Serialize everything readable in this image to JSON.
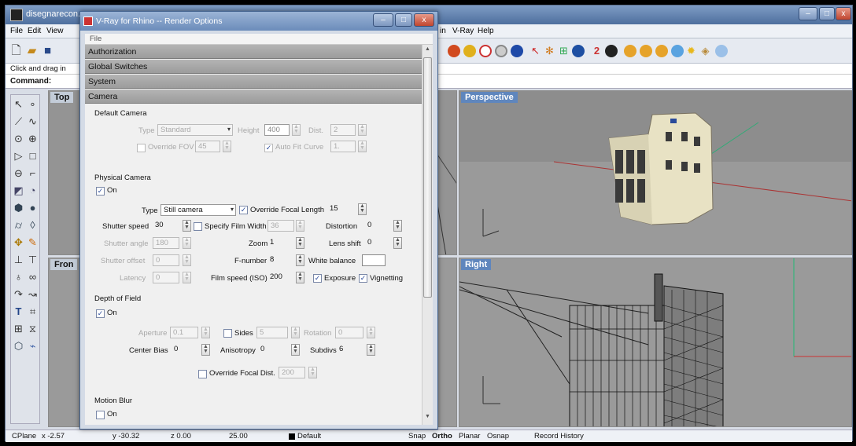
{
  "rhino": {
    "title": "disegnarecon...",
    "menu": [
      "File",
      "Edit",
      "View",
      "in",
      "V-Ray",
      "Help"
    ],
    "command_hint": "Click and drag in",
    "command_label": "Command:",
    "viewports": {
      "top": "Top",
      "front": "Fron",
      "perspective": "Perspective",
      "right": "Right"
    },
    "status": {
      "cplane": "CPlane",
      "x": "x -2.57",
      "y": "y -30.32",
      "z": "z 0.00",
      "value": "25.00",
      "layer": "Default",
      "snap": "Snap",
      "ortho": "Ortho",
      "planar": "Planar",
      "osnap": "Osnap",
      "record": "Record History"
    }
  },
  "vray": {
    "title": "V-Ray for Rhino -- Render Options",
    "menu": "File",
    "sections": {
      "authorization": "Authorization",
      "global": "Global Switches",
      "system": "System",
      "camera": "Camera"
    },
    "default_camera": {
      "heading": "Default Camera",
      "type_label": "Type",
      "type_value": "Standard",
      "height_label": "Height",
      "height_value": "400",
      "dist_label": "Dist.",
      "dist_value": "2",
      "override_fov": "Override FOV",
      "fov_value": "45",
      "auto_fit": "Auto Fit",
      "curve_label": "Curve",
      "curve_value": "1."
    },
    "physical_camera": {
      "heading": "Physical Camera",
      "on": "On",
      "type_label": "Type",
      "type_value": "Still camera",
      "override_focal": "Override Focal Length",
      "focal_value": "15",
      "shutter_speed_label": "Shutter speed",
      "shutter_speed_value": "30",
      "specify_film": "Specify Film Width",
      "film_width_value": "36",
      "distortion_label": "Distortion",
      "distortion_value": "0",
      "shutter_angle_label": "Shutter angle",
      "shutter_angle_value": "180",
      "zoom_label": "Zoom",
      "zoom_value": "1",
      "lens_shift_label": "Lens shift",
      "lens_shift_value": "0",
      "shutter_offset_label": "Shutter offset",
      "shutter_offset_value": "0",
      "fnumber_label": "F-number",
      "fnumber_value": "8",
      "white_balance": "White balance",
      "latency_label": "Latency",
      "latency_value": "0",
      "film_speed_label": "Film speed (ISO)",
      "film_speed_value": "200",
      "exposure": "Exposure",
      "vignetting": "Vignetting"
    },
    "dof": {
      "heading": "Depth of Field",
      "on": "On",
      "aperture_label": "Aperture",
      "aperture_value": "0.1",
      "sides": "Sides",
      "sides_value": "5",
      "rotation_label": "Rotation",
      "rotation_value": "0",
      "center_bias_label": "Center Bias",
      "center_bias_value": "0",
      "anisotropy_label": "Anisotropy",
      "anisotropy_value": "0",
      "subdivs_label": "Subdivs",
      "subdivs_value": "6",
      "override_focal_dist": "Override Focal Dist.",
      "focal_dist_value": "200"
    },
    "motion_blur": {
      "heading": "Motion Blur",
      "on": "On"
    }
  }
}
